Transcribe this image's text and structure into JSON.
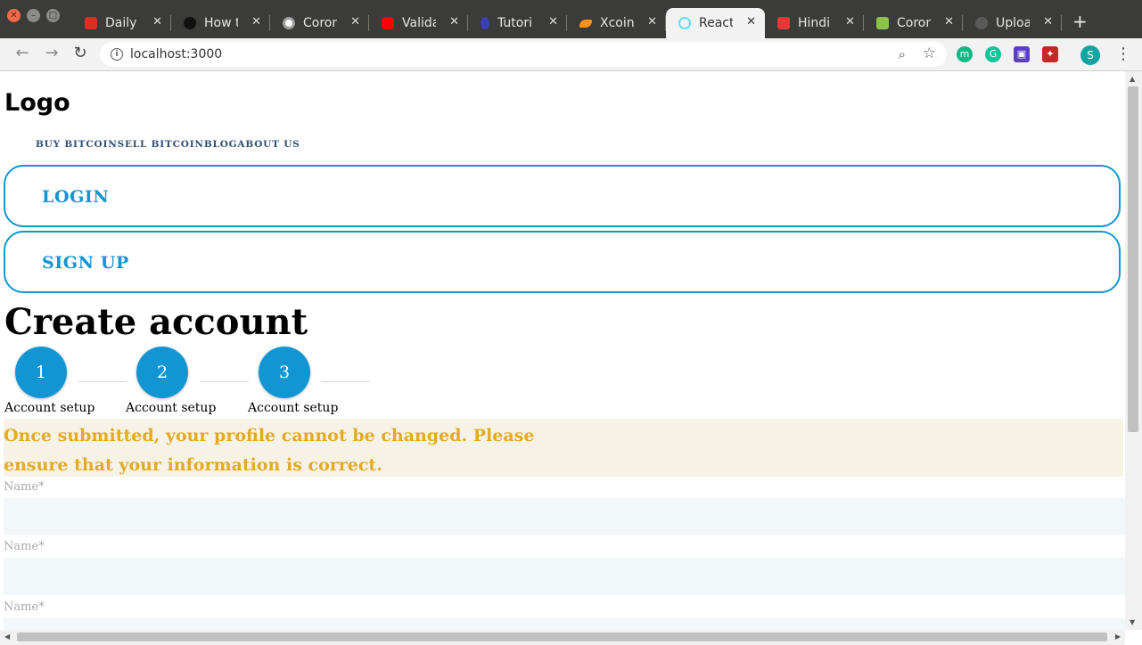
{
  "browser": {
    "tabs": [
      {
        "title": "Daily Sh",
        "fav_color": "#d93025"
      },
      {
        "title": "How to c",
        "fav_color": "#111111"
      },
      {
        "title": "Corona",
        "fav_color": "#9e9e9e"
      },
      {
        "title": "Validat",
        "fav_color": "#ff0000"
      },
      {
        "title": "Tutoria",
        "fav_color": "#3d3db8"
      },
      {
        "title": "Xcoins",
        "fav_color": "#f7931a"
      },
      {
        "title": "React A",
        "fav_color": "#61dafb",
        "active": true
      },
      {
        "title": "Hindi N",
        "fav_color": "#e53935"
      },
      {
        "title": "Corona",
        "fav_color": "#8bc34a"
      },
      {
        "title": "Upload",
        "fav_color": "#5a5a5a"
      }
    ],
    "url": "localhost:3000",
    "extensions": [
      {
        "name": "mixmax-icon",
        "glyph": "m",
        "color": "#12b886"
      },
      {
        "name": "grammarly-icon",
        "glyph": "G",
        "color": "#15c39a"
      },
      {
        "name": "screen-recorder-icon",
        "glyph": "▣",
        "color": "#5b3ec8"
      },
      {
        "name": "puzzle-extension-icon",
        "glyph": "✦",
        "color": "#c62828"
      },
      {
        "name": "profile-avatar",
        "glyph": "S",
        "color": "#12a4a0"
      }
    ]
  },
  "page": {
    "logo": "Logo",
    "nav": [
      "BUY BITCOIN",
      "SELL BITCOIN",
      "BLOG",
      "ABOUT US"
    ],
    "login": "LOGIN",
    "signup": "SIGN UP",
    "heading": "Create account",
    "steps": [
      {
        "number": "1",
        "label": "Account setup"
      },
      {
        "number": "2",
        "label": "Account setup"
      },
      {
        "number": "3",
        "label": "Account setup"
      }
    ],
    "notice": "Once submitted, your profile cannot be changed. Please ensure that your information is correct.",
    "fields": [
      {
        "label": "Name*",
        "value": ""
      },
      {
        "label": "Name*",
        "value": ""
      },
      {
        "label": "Name*",
        "value": ""
      }
    ]
  },
  "colors": {
    "primary": "#1296d3",
    "warning_text": "#e3ab23",
    "notice_bg": "#f7f2e6",
    "input_bg": "#f2f7fa"
  }
}
